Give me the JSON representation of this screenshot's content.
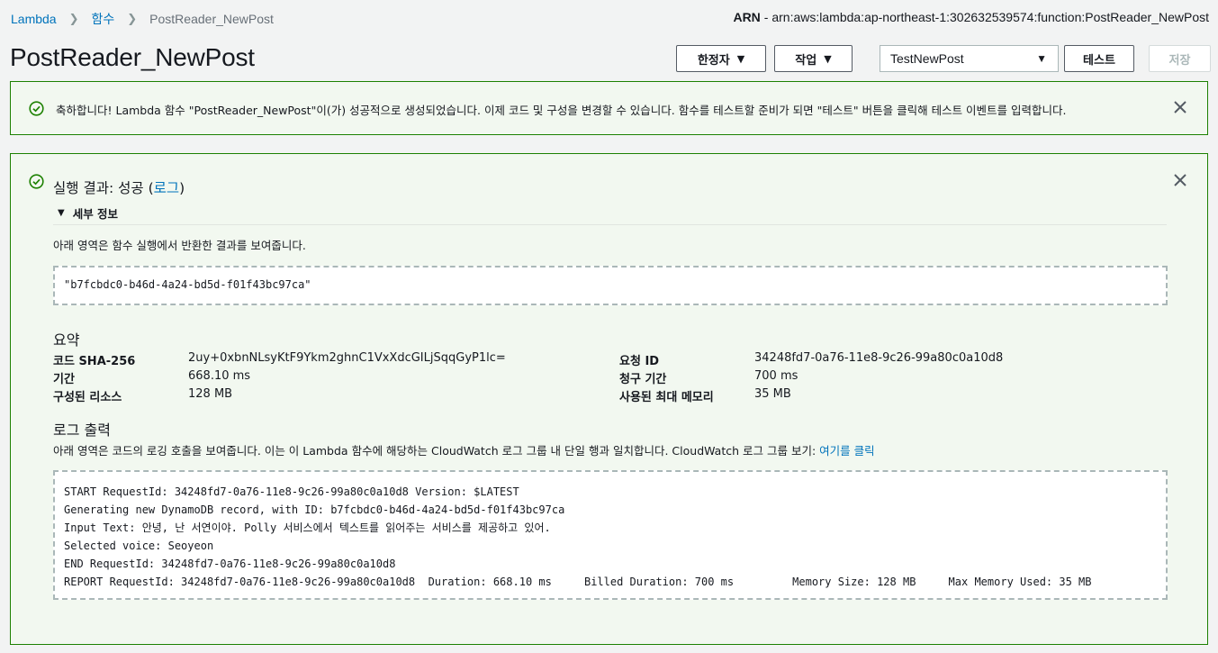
{
  "breadcrumb": {
    "items": [
      "Lambda",
      "함수",
      "PostReader_NewPost"
    ]
  },
  "arn": {
    "label": "ARN",
    "value": "- arn:aws:lambda:ap-northeast-1:302632539574:function:PostReader_NewPost"
  },
  "page_title": "PostReader_NewPost",
  "toolbar": {
    "qualifier_label": "한정자",
    "actions_label": "작업",
    "test_event_selected": "TestNewPost",
    "test_label": "테스트",
    "save_label": "저장"
  },
  "flash": {
    "message": "축하합니다! Lambda 함수 \"PostReader_NewPost\"이(가) 성공적으로 생성되었습니다. 이제 코드 및 구성을 변경할 수 있습니다. 함수를 테스트할 준비가 되면 \"테스트\" 버튼을 클릭해 테스트 이벤트를 입력합니다."
  },
  "execution": {
    "title_prefix": "실행 결과: 성공 (",
    "title_link": "로그",
    "title_suffix": ")",
    "details_label": "세부 정보",
    "result_desc": "아래 영역은 함수 실행에서 반환한 결과를 보여줍니다.",
    "result_value": "\"b7fcbdc0-b46d-4a24-bd5d-f01f43bc97ca\"",
    "summary_title": "요약",
    "summary": {
      "code_sha_label": "코드 SHA-256",
      "code_sha_value": "2uy+0xbnNLsyKtF9Ykm2ghnC1VxXdcGILjSqqGyP1lc=",
      "duration_label": "기간",
      "duration_value": "668.10 ms",
      "resources_label": "구성된 리소스",
      "resources_value": "128 MB",
      "request_id_label": "요청 ID",
      "request_id_value": "34248fd7-0a76-11e8-9c26-99a80c0a10d8",
      "billed_label": "청구 기간",
      "billed_value": "700 ms",
      "max_memory_label": "사용된 최대 메모리",
      "max_memory_value": "35 MB"
    },
    "log_title": "로그 출력",
    "log_desc": "아래 영역은 코드의 로깅 호출을 보여줍니다. 이는 이 Lambda 함수에 해당하는 CloudWatch 로그 그룹 내 단일 행과 일치합니다. CloudWatch 로그 그룹 보기: ",
    "log_link": "여기를 클릭",
    "log_lines": [
      "START RequestId: 34248fd7-0a76-11e8-9c26-99a80c0a10d8 Version: $LATEST",
      "Generating new DynamoDB record, with ID: b7fcbdc0-b46d-4a24-bd5d-f01f43bc97ca",
      "Input Text: 안녕, 난 서연이야. Polly 서비스에서 텍스트를 읽어주는 서비스를 제공하고 있어.",
      "Selected voice: Seoyeon",
      "END RequestId: 34248fd7-0a76-11e8-9c26-99a80c0a10d8",
      "REPORT RequestId: 34248fd7-0a76-11e8-9c26-99a80c0a10d8  Duration: 668.10 ms     Billed Duration: 700 ms         Memory Size: 128 MB     Max Memory Used: 35 MB"
    ]
  },
  "colors": {
    "link": "#0073bb",
    "success": "#1d8102",
    "success_bg": "#f2f8f0"
  },
  "icons": [
    "check-circle-icon",
    "close-icon",
    "caret-down-icon",
    "chevron-right-icon"
  ]
}
